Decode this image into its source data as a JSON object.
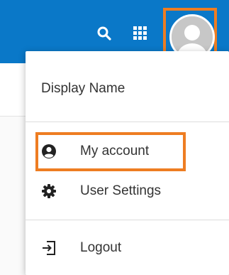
{
  "topbar": {
    "background": "#0a78c8",
    "icons": [
      "search-icon",
      "apps-grid-icon",
      "user-avatar-icon"
    ]
  },
  "menu": {
    "display_name": "Display Name",
    "items": [
      {
        "label": "My account",
        "icon": "account-circle-icon"
      },
      {
        "label": "User Settings",
        "icon": "gear-icon"
      },
      {
        "label": "Logout",
        "icon": "logout-icon"
      }
    ]
  },
  "highlight_color": "#ee7d22"
}
